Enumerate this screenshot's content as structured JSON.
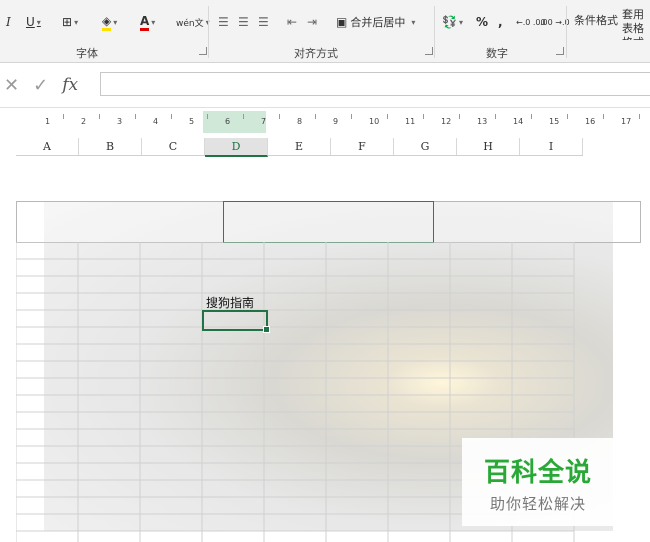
{
  "ribbon": {
    "font_group_label": "字体",
    "align_group_label": "对齐方式",
    "number_group_label": "数字",
    "italic_label": "I",
    "underline_label": "U",
    "font_color_label": "A",
    "wen_label": "wén文",
    "merge_label": "合并后居中",
    "percent_label": "%",
    "comma_label": ",",
    "dec_increase_label": "←.0 .00",
    "dec_decrease_label": ".00 →.0",
    "conditional_format_label": "条件格式",
    "table_format_label": "套用表格格式",
    "accent": "#217346"
  },
  "formula_bar": {
    "cancel_icon": "✕",
    "confirm_icon": "✓",
    "fx_label": "fx",
    "value": ""
  },
  "ruler": {
    "ticks": [
      "1",
      "2",
      "3",
      "4",
      "5",
      "6",
      "7",
      "8",
      "9",
      "10",
      "11",
      "12",
      "13",
      "14",
      "15",
      "16",
      "17"
    ]
  },
  "columns": [
    "A",
    "B",
    "C",
    "D",
    "E",
    "F",
    "G",
    "H",
    "I"
  ],
  "active_column": "D",
  "cell_text": "搜狗指南",
  "watermark": {
    "line1": "百科全说",
    "line2": "助你轻松解决"
  }
}
